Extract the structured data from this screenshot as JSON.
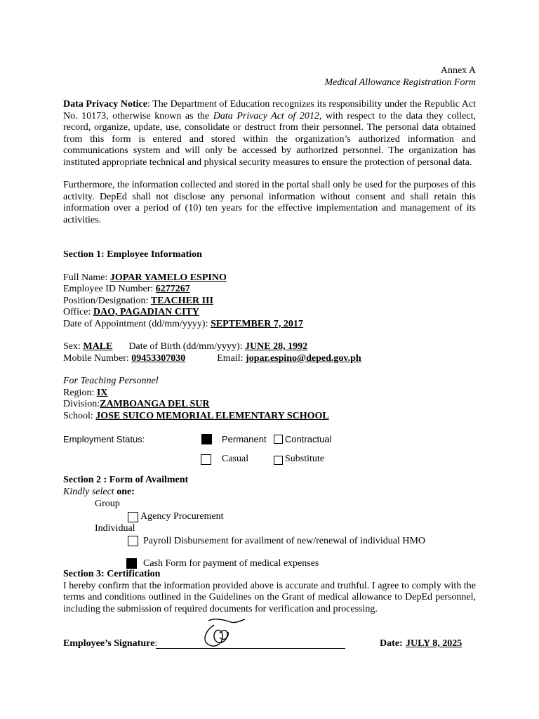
{
  "header": {
    "annex": "Annex A",
    "form_title": "Medical Allowance Registration Form"
  },
  "privacy": {
    "title": "Data Privacy Notice",
    "p1_a": ": The Department of Education recognizes its responsibility under the Republic Act No. 10173, otherwise known as the ",
    "p1_act": "Data Privacy Act of 2012",
    "p1_b": ", with respect to the data they collect, record, organize, update, use, consolidate or destruct from their personnel. The personal data obtained from this form is entered and stored within the organization’s authorized information and communications system and will only be accessed by authorized personnel. The organization has instituted appropriate technical and physical security measures to ensure the protection of personal data.",
    "p2": "Furthermore, the information collected and stored in the portal shall only be used for the purposes of this activity. DepEd shall not disclose any personal information without consent and shall retain this information over a period of (10) ten years for the effective implementation and management of its activities."
  },
  "section1": {
    "title": "Section 1: Employee Information",
    "full_name_label": "Full Name: ",
    "full_name": "JOPAR YAMELO ESPINO",
    "emp_id_label": "Employee ID Number: ",
    "emp_id": "6277267",
    "position_label": "Position/Designation: ",
    "position": "TEACHER III",
    "office_label": "Office: ",
    "office": "DAO, PAGADIAN CITY",
    "appt_label": "Date of Appointment (dd/mm/yyyy): ",
    "appt": "SEPTEMBER 7, 2017",
    "sex_label": "Sex: ",
    "sex": "MALE",
    "dob_label": "Date of Birth (dd/mm/yyyy): ",
    "dob": "JUNE 28, 1992",
    "mobile_label": "Mobile Number: ",
    "mobile": "09453307030",
    "email_label": "Email: ",
    "email": "jopar.espino@deped.gov.ph",
    "teaching_label": "For Teaching Personnel",
    "region_label": "Region: ",
    "region": "IX",
    "division_label": "Division:",
    "division": "ZAMBOANGA DEL SUR",
    "school_label": "School: ",
    "school": "JOSE SUICO MEMORIAL ELEMENTARY SCHOOL",
    "status_label": "Employment Status:",
    "status_options": [
      {
        "label": "Permanent",
        "checked": true
      },
      {
        "label": "Contractual",
        "checked": false
      },
      {
        "label": "Casual",
        "checked": false
      },
      {
        "label": "Substitute",
        "checked": false
      }
    ]
  },
  "section2": {
    "title": "Section 2 : Form of Availment",
    "kindly": "Kindly select ",
    "one": "one:",
    "group_label": "Group",
    "agency": "Agency Procurement",
    "individual_label": "Individual",
    "payroll": "Payroll Disbursement for availment of new/renewal of individual HMO",
    "cash": "Cash Form for payment of medical expenses",
    "agency_checked": false,
    "payroll_checked": false,
    "cash_checked": true
  },
  "section3": {
    "title": "Section 3: Certification",
    "text": "I hereby confirm that the information provided above is accurate and truthful. I agree to comply with the terms and conditions outlined in the Guidelines on the Grant of medical allowance to DepEd personnel, including the submission of required documents for verification and processing.",
    "sig_label": "Employee’s Signature",
    "sig_colon": ":",
    "date_label": "Date: ",
    "date": "JULY 8, 2025"
  }
}
